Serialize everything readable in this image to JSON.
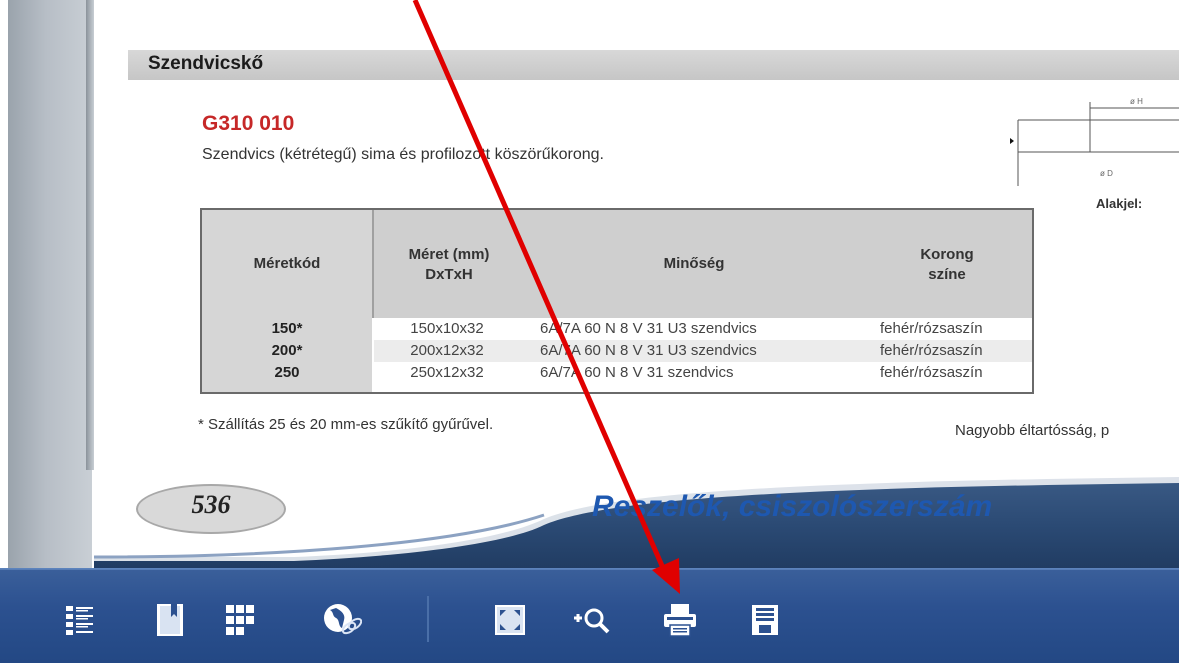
{
  "document": {
    "section_title": "Szendvicskő",
    "product_code": "G310 010",
    "product_description": "Szendvics (kétrétegű) sima és profilozott köszörűkorong.",
    "shape_label": "Alakjel:",
    "table": {
      "headers": [
        "Méretkód",
        "Méret (mm)\nDxTxH",
        "Minőség",
        "Korong\nszíne"
      ],
      "rows": [
        {
          "code": "150*",
          "size": "150x10x32",
          "quality": "6A/7A 60 N 8 V 31 U3 szendvics",
          "color": "fehér/rózsaszín"
        },
        {
          "code": "200*",
          "size": "200x12x32",
          "quality": "6A/7A 60 N 8 V 31 U3 szendvics",
          "color": "fehér/rózsaszín"
        },
        {
          "code": "250",
          "size": "250x12x32",
          "quality": "6A/7A 60 N 8 V 31 szendvics",
          "color": "fehér/rózsaszín"
        }
      ]
    },
    "footnote": "* Szállítás 25 és 20 mm-es szűkítő gyűrűvel.",
    "side_note": "Nagyobb éltartósság, p"
  },
  "page_footer": {
    "page_number": "536",
    "chapter_title": "Reszelők, csiszolószerszám"
  },
  "toolbar": {
    "buttons": [
      {
        "icon": "table-of-contents-icon"
      },
      {
        "icon": "bookmark-icon"
      },
      {
        "icon": "thumbnails-grid-icon"
      },
      {
        "icon": "web-link-icon"
      },
      {
        "icon": "fullscreen-icon"
      },
      {
        "icon": "zoom-in-icon"
      },
      {
        "icon": "print-icon"
      },
      {
        "icon": "save-icon"
      }
    ]
  },
  "colors": {
    "product_code": "#c62828",
    "banner_title": "#1e58b0",
    "toolbar": "#2c5190",
    "annotation_arrow": "#e00000"
  }
}
